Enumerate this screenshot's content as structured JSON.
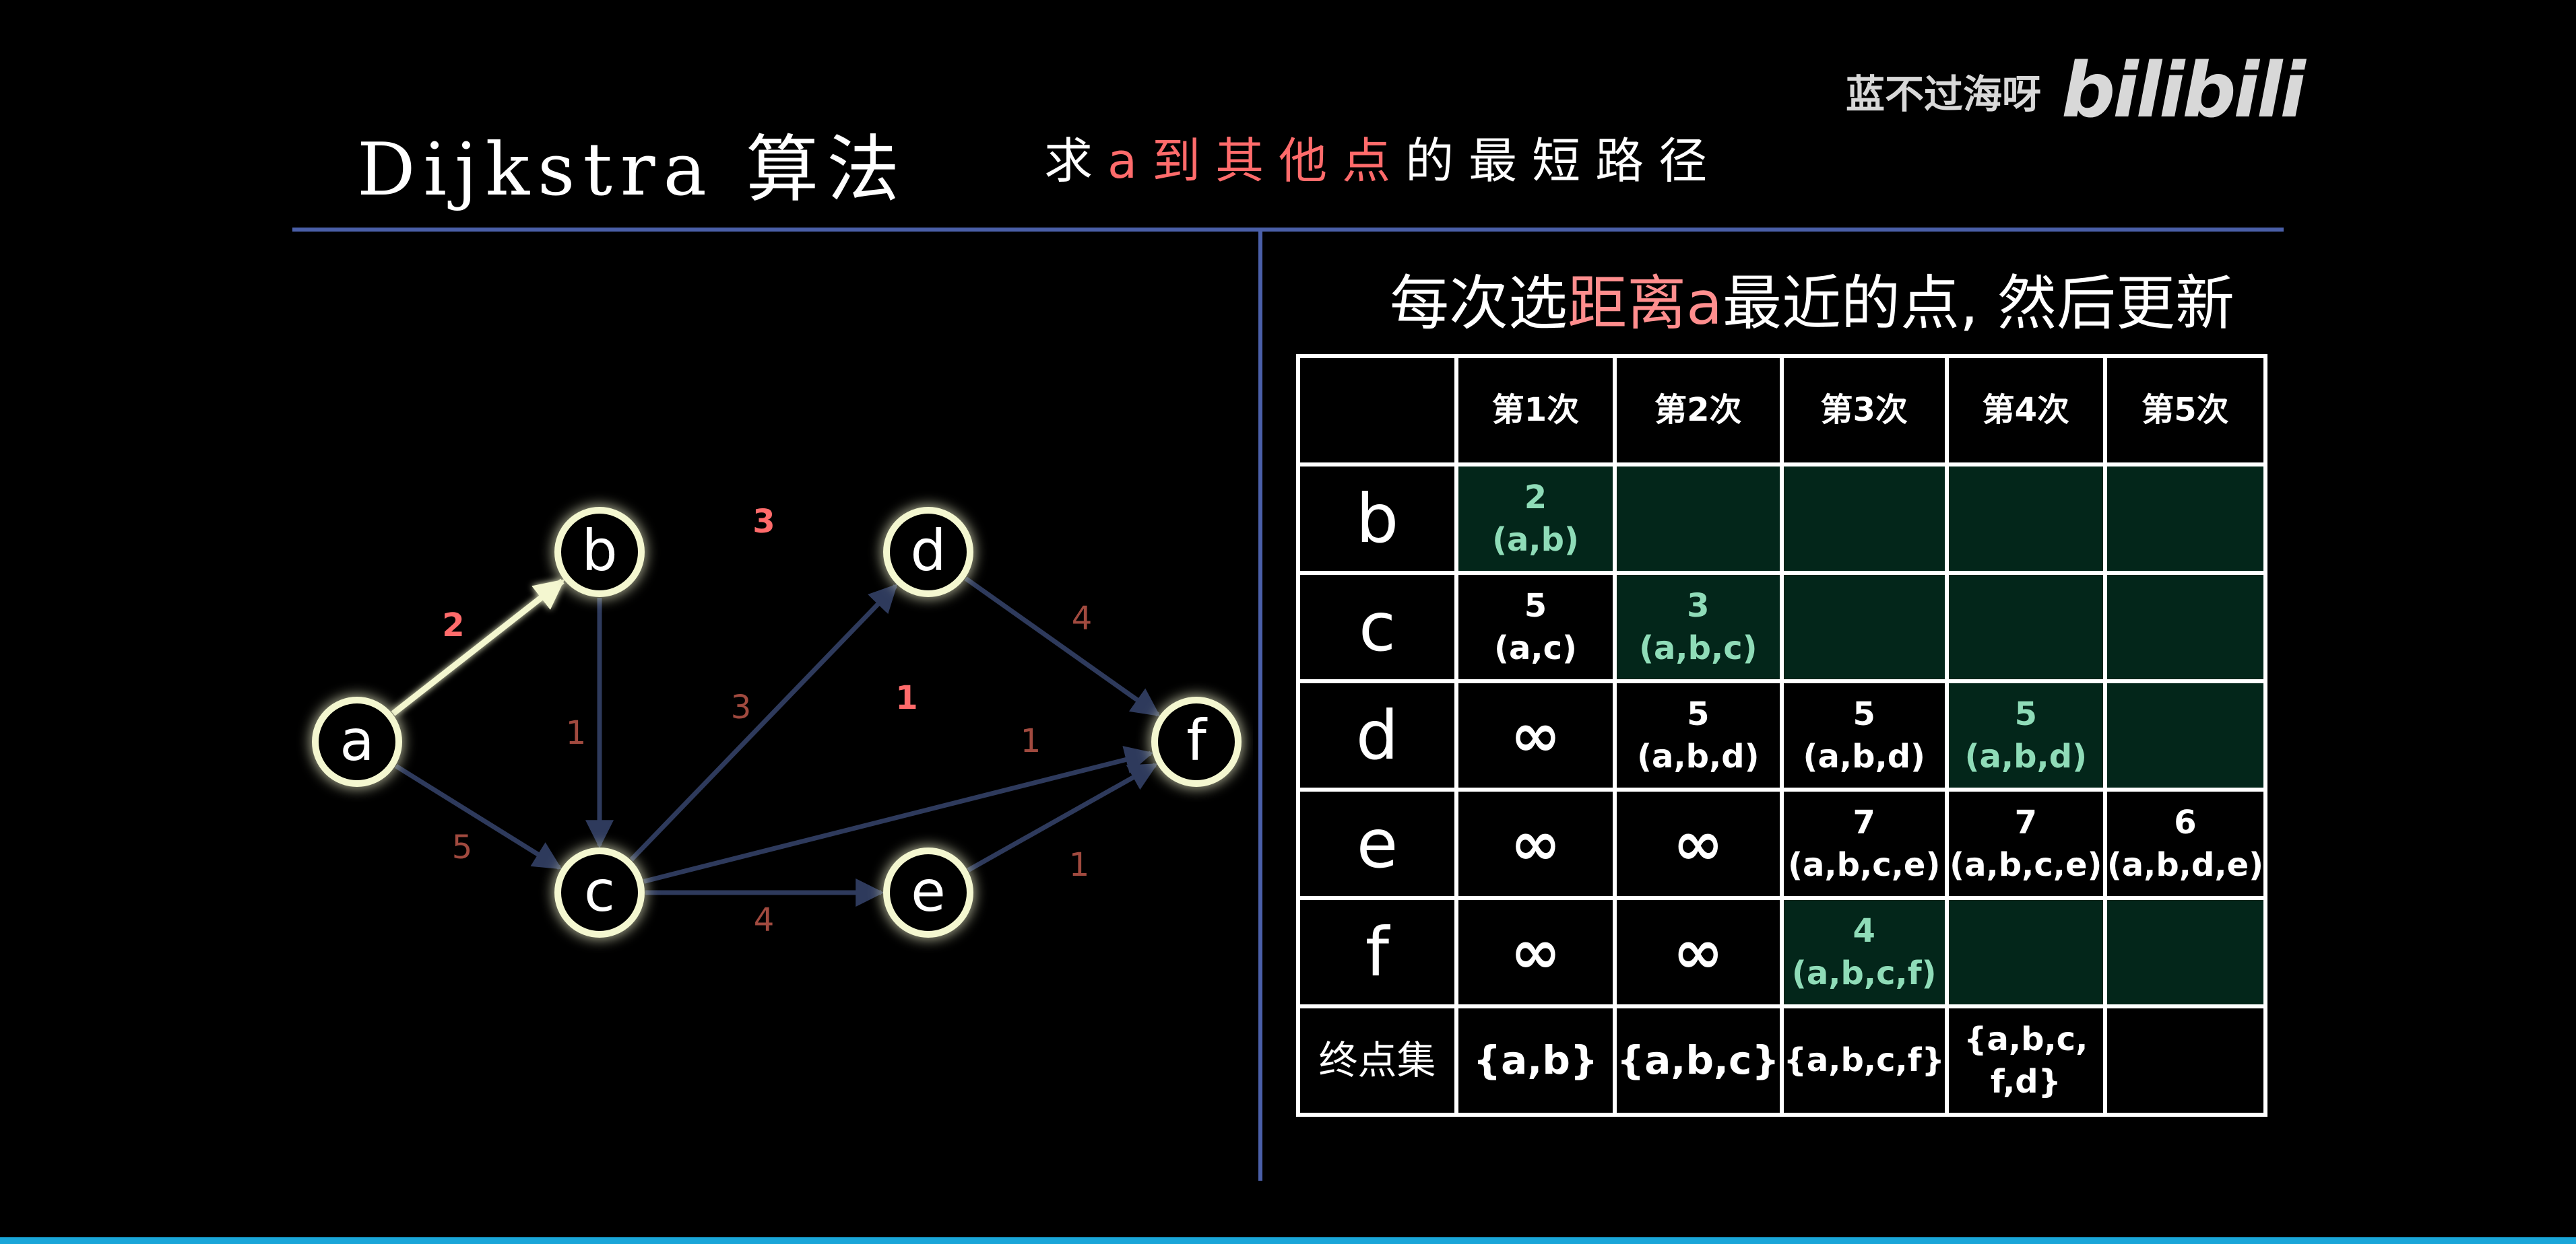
{
  "header": {
    "title": "Dijkstra 算法",
    "subtitle_pre": "求",
    "subtitle_red": "a到其他点",
    "subtitle_post": "的最短路径"
  },
  "watermark": {
    "name": "蓝不过海呀",
    "logo": "bilibili"
  },
  "rule": {
    "pre": "每次选",
    "pink": "距离a",
    "post": "最近的点, 然后更新"
  },
  "graph": {
    "nodes": [
      {
        "id": "a",
        "label": "a"
      },
      {
        "id": "b",
        "label": "b"
      },
      {
        "id": "c",
        "label": "c"
      },
      {
        "id": "d",
        "label": "d"
      },
      {
        "id": "e",
        "label": "e"
      },
      {
        "id": "f",
        "label": "f"
      }
    ],
    "edges": [
      {
        "from": "a",
        "to": "b",
        "weight": "2",
        "highlight": true
      },
      {
        "from": "a",
        "to": "c",
        "weight": "5",
        "highlight": false
      },
      {
        "from": "b",
        "to": "c",
        "weight": "1",
        "highlight": false
      },
      {
        "from": "b",
        "to": "d",
        "weight": "3",
        "highlight": true
      },
      {
        "from": "c",
        "to": "d",
        "weight": "3",
        "highlight": false
      },
      {
        "from": "c",
        "to": "e",
        "weight": "4",
        "highlight": false
      },
      {
        "from": "c",
        "to": "f",
        "weight": "1",
        "highlight": false
      },
      {
        "from": "d",
        "to": "e",
        "weight": "1",
        "highlight": true
      },
      {
        "from": "d",
        "to": "f",
        "weight": "4",
        "highlight": false
      },
      {
        "from": "e",
        "to": "f",
        "weight": "1",
        "highlight": false
      }
    ],
    "colors": {
      "edge": "#2e3a5c",
      "edge_highlight": "#f4f7d0",
      "weight": "#a14a3f",
      "weight_highlight": "#ff6b6b",
      "node_glow": "#f4f7d0"
    }
  },
  "table": {
    "headers": [
      "",
      "第1次",
      "第2次",
      "第3次",
      "第4次",
      "第5次"
    ],
    "rows": [
      {
        "label": "b",
        "cells": [
          {
            "v": "2",
            "p": "(a,b)",
            "green": true
          },
          {
            "v": "",
            "p": "",
            "green": true
          },
          {
            "v": "",
            "p": "",
            "green": true
          },
          {
            "v": "",
            "p": "",
            "green": true
          },
          {
            "v": "",
            "p": "",
            "green": true
          }
        ]
      },
      {
        "label": "c",
        "cells": [
          {
            "v": "5",
            "p": "(a,c)",
            "green": false
          },
          {
            "v": "3",
            "p": "(a,b,c)",
            "green": true
          },
          {
            "v": "",
            "p": "",
            "green": true
          },
          {
            "v": "",
            "p": "",
            "green": true
          },
          {
            "v": "",
            "p": "",
            "green": true
          }
        ]
      },
      {
        "label": "d",
        "cells": [
          {
            "v": "∞",
            "p": "",
            "green": false
          },
          {
            "v": "5",
            "p": "(a,b,d)",
            "green": false
          },
          {
            "v": "5",
            "p": "(a,b,d)",
            "green": false
          },
          {
            "v": "5",
            "p": "(a,b,d)",
            "green": true
          },
          {
            "v": "",
            "p": "",
            "green": true
          }
        ]
      },
      {
        "label": "e",
        "cells": [
          {
            "v": "∞",
            "p": "",
            "green": false
          },
          {
            "v": "∞",
            "p": "",
            "green": false
          },
          {
            "v": "7",
            "p": "(a,b,c,e)",
            "green": false
          },
          {
            "v": "7",
            "p": "(a,b,c,e)",
            "green": false
          },
          {
            "v": "6",
            "p": "(a,b,d,e)",
            "green": false
          }
        ]
      },
      {
        "label": "f",
        "cells": [
          {
            "v": "∞",
            "p": "",
            "green": false
          },
          {
            "v": "∞",
            "p": "",
            "green": false
          },
          {
            "v": "4",
            "p": "(a,b,c,f)",
            "green": true
          },
          {
            "v": "",
            "p": "",
            "green": true
          },
          {
            "v": "",
            "p": "",
            "green": true
          }
        ]
      }
    ],
    "footer": {
      "label": "终点集",
      "sets": [
        "{a,b}",
        "{a,b,c}",
        "{a,b,c,f}",
        "{a,b,c,\nf,d}",
        ""
      ]
    },
    "colors": {
      "green_bg": "#03261a",
      "green_text": "#8fdcb8"
    }
  }
}
